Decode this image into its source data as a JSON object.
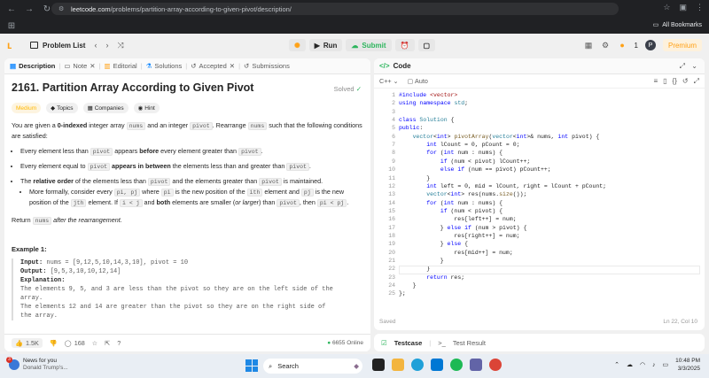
{
  "browser": {
    "url_host": "leetcode.com",
    "url_path": "/problems/partition-array-according-to-given-pivot/description/",
    "bookmarks_label": "All Bookmarks"
  },
  "topbar": {
    "problem_list": "Problem List",
    "run": "Run",
    "submit": "Submit",
    "streak": "1",
    "avatar": "P",
    "premium": "Premium"
  },
  "left_tabs": [
    "Description",
    "Note",
    "Editorial",
    "Solutions",
    "Accepted",
    "Submissions"
  ],
  "problem": {
    "title": "2161. Partition Array According to Given Pivot",
    "solved": "Solved",
    "tags": [
      "Medium",
      "Topics",
      "Companies",
      "Hint"
    ],
    "intro_1": "You are given a ",
    "intro_bold": "0-indexed",
    "intro_2": " integer array ",
    "intro_nums": "nums",
    "intro_3": " and an integer ",
    "intro_pivot": "pivot",
    "intro_4": ". Rearrange ",
    "intro_nums2": "nums",
    "intro_5": " such that the following conditions are satisfied:",
    "b1_a": "Every element less than ",
    "b1_code": "pivot",
    "b1_b": " appears ",
    "b1_bold": "before",
    "b1_c": " every element greater than ",
    "b1_code2": "pivot",
    "b1_d": ".",
    "b2_a": "Every element equal to ",
    "b2_code": "pivot",
    "b2_bold": " appears in between",
    "b2_c": " the elements less than and greater than ",
    "b2_code2": "pivot",
    "b2_d": ".",
    "b3_a": "The ",
    "b3_bold": "relative order",
    "b3_b": " of the elements less than ",
    "b3_code": "pivot",
    "b3_c": " and the elements greater than ",
    "b3_code2": "pivot",
    "b3_d": " is maintained.",
    "b4_a": "More formally, consider every ",
    "b4_code": "pi, pj",
    "b4_b": " where ",
    "b4_code2": "pi",
    "b4_c": " is the new position of the ",
    "b4_code3": "ith",
    "b4_d": " element and ",
    "b4_code4": "pj",
    "b4_e": " is the new position of the ",
    "b4_code5": "jth",
    "b4_f": " element. If ",
    "b4_code6": "i < j",
    "b4_g": " and ",
    "b4_bold": "both",
    "b4_h": " elements are smaller (",
    "b4_ital": "or larger",
    "b4_i": ") than ",
    "b4_code7": "pivot",
    "b4_j": ", then ",
    "b4_code8": "pi < pj",
    "b4_k": ".",
    "ret_a": "Return ",
    "ret_code": "nums",
    "ret_b": " after the rearrangement.",
    "example_title": "Example 1:",
    "ex_input_label": "Input:",
    "ex_input": " nums = [9,12,5,10,14,3,10], pivot = 10",
    "ex_output_label": "Output:",
    "ex_output": " [9,5,3,10,10,12,14]",
    "ex_expl_label": "Explanation:",
    "ex_expl_1": "The elements 9, 5, and 3 are less than the pivot so they are on the left side of the",
    "ex_expl_2": "array.",
    "ex_expl_3": "The elements 12 and 14 are greater than the pivot so they are on the right side of",
    "ex_expl_4": "the array."
  },
  "left_footer": {
    "likes": "1.5K",
    "comments": "168",
    "online": "6655 Online"
  },
  "code_panel": {
    "tab": "Code",
    "language": "C++",
    "mode": "Auto",
    "saved": "Saved",
    "position": "Ln 22, Col 10",
    "lines": [
      "#include <vector>",
      "using namespace std;",
      "",
      "class Solution {",
      "public:",
      "    vector<int> pivotArray(vector<int>& nums, int pivot) {",
      "        int lCount = 0, pCount = 0;",
      "        for (int num : nums) {",
      "            if (num < pivot) lCount++;",
      "            else if (num == pivot) pCount++;",
      "        }",
      "        int left = 0, mid = lCount, right = lCount + pCount;",
      "        vector<int> res(nums.size());",
      "        for (int num : nums) {",
      "            if (num < pivot) {",
      "                res[left++] = num;",
      "            } else if (num > pivot) {",
      "                res[right++] = num;",
      "            } else {",
      "                res[mid++] = num;",
      "            }",
      "        }",
      "        return res;",
      "    }",
      "};"
    ]
  },
  "test_panel": {
    "testcase": "Testcase",
    "result": "Test Result"
  },
  "taskbar": {
    "news_title": "News for you",
    "news_sub": "Donald Trump's...",
    "news_badge": "3",
    "search": "Search",
    "time": "10:48 PM",
    "date": "3/3/2025"
  },
  "colors": {
    "accent_orange": "#ffa116",
    "success_green": "#2db55d"
  }
}
